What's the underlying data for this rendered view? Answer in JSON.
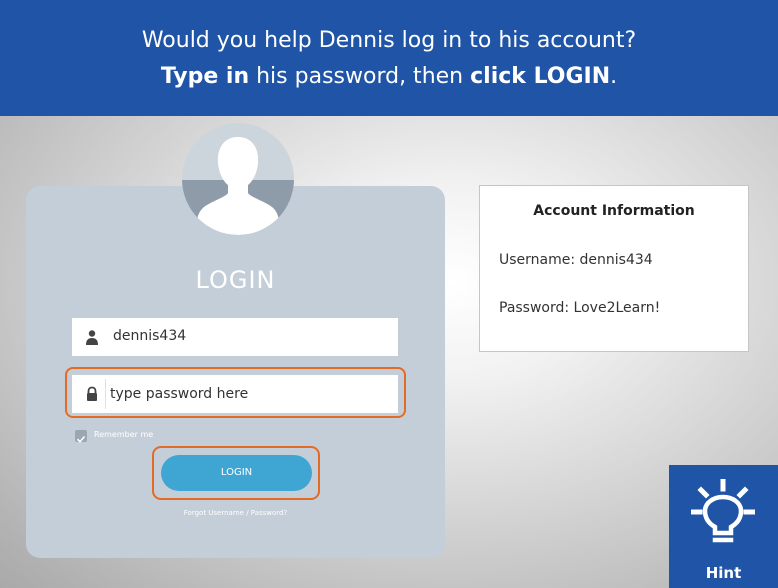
{
  "banner": {
    "line1": "Would you help Dennis log in to his account?",
    "line2_bold1": "Type in",
    "line2_text1": " his password, then ",
    "line2_bold2": "click LOGIN",
    "line2_end": "."
  },
  "login_form": {
    "title": "LOGIN",
    "username_value": "dennis434",
    "username_icon": "user-icon",
    "password_placeholder": "type password here",
    "password_icon": "lock-icon",
    "remember_label": "Remember me",
    "remember_checked": true,
    "login_button_label": "LOGIN",
    "forgot_link": "Forgot Username / Password?"
  },
  "account_info": {
    "title": "Account Information",
    "username_line": "Username: dennis434",
    "password_line": "Password: Love2Learn!"
  },
  "hint": {
    "label": "Hint",
    "icon": "lightbulb-icon"
  },
  "colors": {
    "banner": "#1f54a6",
    "highlight": "#e46b25",
    "login_button": "#3fa6d4",
    "card": "#c4ced8"
  }
}
